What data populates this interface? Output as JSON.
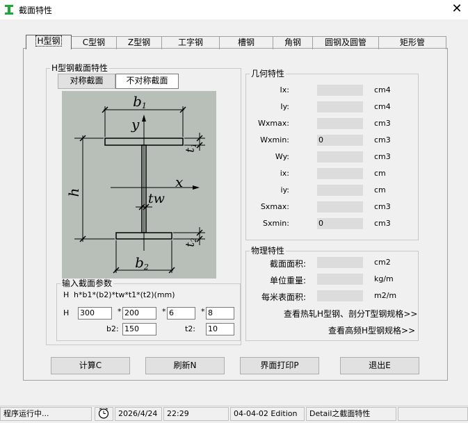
{
  "window": {
    "title": "截面特性"
  },
  "tabs": [
    "H型钢",
    "C型钢",
    "Z型钢",
    "工字钢",
    "槽钢",
    "角钢",
    "圆钢及圆管",
    "矩形管"
  ],
  "hsection": {
    "group_title": "H型钢截面特性",
    "btn_symmetric": "对称截面",
    "btn_asymmetric": "不对称截面",
    "diagram_labels": {
      "b1": "b",
      "b1_sub": "1",
      "b2": "b",
      "b2_sub": "2",
      "y": "y",
      "x": "x",
      "h": "h",
      "tw": "tw",
      "t1": "t",
      "t1_sub": "1",
      "t2": "t",
      "t2_sub": "2"
    }
  },
  "input": {
    "group_title": "输入截面参数",
    "formula_prefix": "H",
    "formula": "h*b1*(b2)*tw*t1*(t2)(mm)",
    "row_label": "H",
    "h": "300",
    "b1": "200",
    "tw": "6",
    "t1": "8",
    "times": "*",
    "b2_label": "b2:",
    "b2": "150",
    "t2_label": "t2:",
    "t2": "10"
  },
  "geometry": {
    "group_title": "几何特性",
    "rows": [
      {
        "label": "Ix:",
        "value": "",
        "unit": "cm4"
      },
      {
        "label": "Iy:",
        "value": "",
        "unit": "cm4"
      },
      {
        "label": "Wxmax:",
        "value": "",
        "unit": "cm3"
      },
      {
        "label": "Wxmin:",
        "value": "0",
        "unit": "cm3"
      },
      {
        "label": "Wy:",
        "value": "",
        "unit": "cm3"
      },
      {
        "label": "ix:",
        "value": "",
        "unit": "cm"
      },
      {
        "label": "iy:",
        "value": "",
        "unit": "cm"
      },
      {
        "label": "Sxmax:",
        "value": "",
        "unit": "cm3"
      },
      {
        "label": "Sxmin:",
        "value": "0",
        "unit": "cm3"
      }
    ]
  },
  "physical": {
    "group_title": "物理特性",
    "rows": [
      {
        "label": "截面面积:",
        "value": "",
        "unit": "cm2"
      },
      {
        "label": "单位重量:",
        "value": "",
        "unit": "kg/m"
      },
      {
        "label": "每米表面积:",
        "value": "",
        "unit": "m2/m"
      }
    ],
    "link_hot_rolled": "查看热轧H型钢、剖分T型钢规格>>",
    "link_high_freq": "查看高频H型钢规格>>"
  },
  "buttons": {
    "calc": "计算C",
    "refresh": "刷新N",
    "print": "界面打印P",
    "exit": "退出E"
  },
  "status": {
    "running": "程序运行中...",
    "date": "2026/4/24",
    "time": "22:29",
    "edition": "04-04-02 Edition",
    "module": "Detail之截面特性"
  },
  "colors": {
    "diagram_bg": "#b8bfb8",
    "accent_icon": "#1aaa3a"
  }
}
